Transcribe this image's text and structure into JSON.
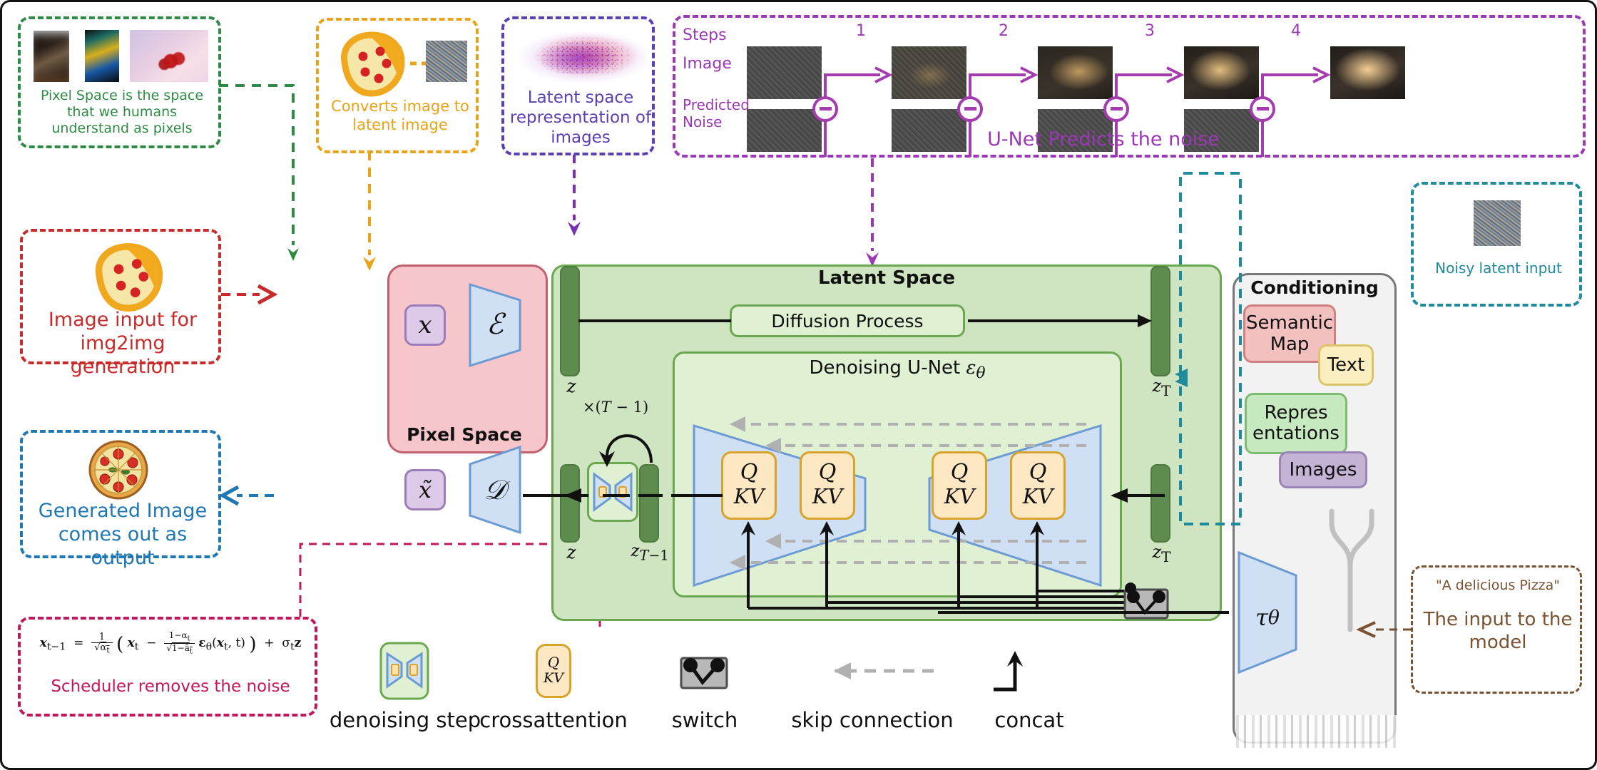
{
  "annotations": {
    "pixel_space_note": {
      "text": "Pixel Space is the space that we humans understand as pixels",
      "color": "#2e8b45"
    },
    "converts_note": {
      "text": "Converts image to latent image",
      "color": "#e8a317"
    },
    "latent_note": {
      "text": "Latent space representation of images",
      "color": "#6a3fc0"
    },
    "unet_note": {
      "title": "U-Net Predicts the noise",
      "row_labels": [
        "Steps",
        "Image",
        "Predicted Noise"
      ],
      "step_numbers": [
        "1",
        "2",
        "3",
        "4"
      ],
      "color": "#9b38b5"
    },
    "img2img_note": {
      "text": "Image input for img2img generation",
      "color": "#c92a2a"
    },
    "generated_note": {
      "text": "Generated Image comes out as output",
      "color": "#1f77b4"
    },
    "scheduler_note": {
      "text": "Scheduler removes the noise",
      "formula": "xₜ₋₁ = 1/√αₜ ( xₜ − (1−αₜ)/√(1−āₜ) ϵθ(xₜ, t) ) + σₜ z",
      "color": "#c2185b"
    },
    "noisy_latent_note": {
      "text": "Noisy latent input",
      "color": "#1f8a9c"
    },
    "input_model_note": {
      "prompt": "\"A delicious Pizza\"",
      "text": "The input to the model",
      "color": "#7a5230"
    }
  },
  "diagram": {
    "pixel_space": {
      "title": "Pixel Space",
      "input_symbol": "x",
      "output_symbol": "x̃",
      "encoder_symbol": "ℰ",
      "decoder_symbol": "𝒟"
    },
    "latent_space": {
      "title": "Latent Space",
      "diffusion_process": "Diffusion Process",
      "unet_title": "Denoising U-Net ϵθ",
      "loop_label": "×(T − 1)",
      "z_label": "z",
      "z_label_2": "z",
      "zT_label": "z_T",
      "zT_right_label": "z_T",
      "zTm1_label": "z_{T−1}",
      "qkv_blocks": [
        {
          "q": "Q",
          "kv": "KV"
        },
        {
          "q": "Q",
          "kv": "KV"
        },
        {
          "q": "Q",
          "kv": "KV"
        },
        {
          "q": "Q",
          "kv": "KV"
        }
      ]
    },
    "conditioning": {
      "title": "Conditioning",
      "items": [
        {
          "label": "Semantic Map",
          "color": "#f3c0c0"
        },
        {
          "label": "Text",
          "color": "#fbeec1"
        },
        {
          "label": "Repres entations",
          "color": "#c7e9c0"
        },
        {
          "label": "Images",
          "color": "#c5b3d6"
        }
      ],
      "tau_symbol": "τθ"
    },
    "legend": [
      {
        "name": "denoising step",
        "icon": "denoising-step-icon"
      },
      {
        "name": "crossattention",
        "icon": "crossattention-icon"
      },
      {
        "name": "switch",
        "icon": "switch-icon"
      },
      {
        "name": "skip connection",
        "icon": "skip-connection-icon"
      },
      {
        "name": "concat",
        "icon": "concat-icon"
      }
    ]
  },
  "colors": {
    "pixel_space_bg": "#f6c6cb",
    "pixel_space_border": "#c1606c",
    "latent_space_bg": "#cfe5c2",
    "latent_space_border": "#6aa84f",
    "unet_bg": "#dff0d3",
    "trapezoid_fill": "#cfe0f5",
    "trapezoid_stroke": "#6b9bd2",
    "green_bar": "#5e8c4e",
    "qkv_fill": "#fde8c3",
    "qkv_stroke": "#d8a32b",
    "conditioning_bg": "#f2f2f2",
    "conditioning_border": "#777777"
  }
}
